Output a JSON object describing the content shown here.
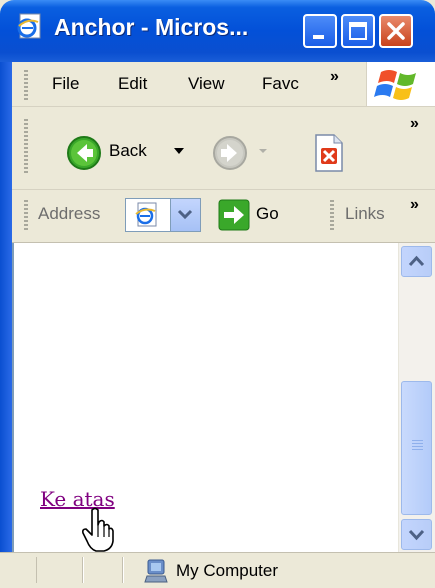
{
  "window": {
    "title": "Anchor - Micros..."
  },
  "menubar": {
    "items": [
      "File",
      "Edit",
      "View",
      "Favc"
    ],
    "overflow": "»"
  },
  "toolbar": {
    "back_label": "Back",
    "overflow": "»"
  },
  "addressbar": {
    "address_label": "Address",
    "go_label": "Go",
    "links_label": "Links",
    "overflow": "»"
  },
  "content": {
    "link_text": "Ke atas"
  },
  "statusbar": {
    "zone": "My Computer"
  },
  "colors": {
    "titlebar_blue": "#0350d8",
    "link_visited": "#800080",
    "chrome": "#ece9d8"
  }
}
